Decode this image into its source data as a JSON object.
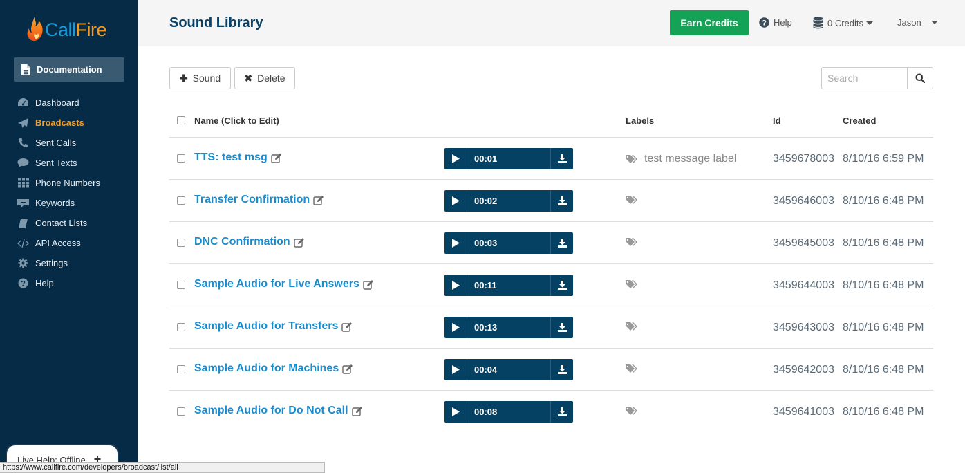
{
  "app": {
    "logo_part1": "Call",
    "logo_part2": "Fire"
  },
  "sidebar": {
    "documentation_label": "Documentation",
    "items": [
      {
        "label": "Dashboard",
        "icon": "dashboard-icon",
        "active": false
      },
      {
        "label": "Broadcasts",
        "icon": "paper-plane-icon",
        "active": true
      },
      {
        "label": "Sent Calls",
        "icon": "phone-icon",
        "active": false
      },
      {
        "label": "Sent Texts",
        "icon": "chat-bubble-icon",
        "active": false
      },
      {
        "label": "Phone Numbers",
        "icon": "keypad-grid-icon",
        "active": false
      },
      {
        "label": "Keywords",
        "icon": "keyword-icon",
        "active": false
      },
      {
        "label": "Contact Lists",
        "icon": "address-book-icon",
        "active": false
      },
      {
        "label": "API Access",
        "icon": "code-icon",
        "active": false
      },
      {
        "label": "Settings",
        "icon": "gear-icon",
        "active": false
      },
      {
        "label": "Help",
        "icon": "question-circle-icon",
        "active": false
      }
    ],
    "live_help_label": "Live Help: Offline"
  },
  "status_bar": {
    "url": "https://www.callfire.com/developers/broadcast/list/all"
  },
  "header": {
    "title": "Sound Library",
    "earn_credits_label": "Earn Credits",
    "help_label": "Help",
    "credits_label": "0 Credits",
    "user_name": "Jason"
  },
  "toolbar": {
    "add_sound_label": "Sound",
    "delete_label": "Delete",
    "search_placeholder": "Search",
    "search_value": ""
  },
  "table": {
    "columns": {
      "name": "Name (Click to Edit)",
      "labels": "Labels",
      "id": "Id",
      "created": "Created"
    },
    "rows": [
      {
        "name": "TTS: test msg",
        "duration": "00:01",
        "label": "test message label",
        "id": "3459678003",
        "created": "8/10/16 6:59 PM"
      },
      {
        "name": "Transfer Confirmation",
        "duration": "00:02",
        "label": "",
        "id": "3459646003",
        "created": "8/10/16 6:48 PM"
      },
      {
        "name": "DNC Confirmation",
        "duration": "00:03",
        "label": "",
        "id": "3459645003",
        "created": "8/10/16 6:48 PM"
      },
      {
        "name": "Sample Audio for Live Answers",
        "duration": "00:11",
        "label": "",
        "id": "3459644003",
        "created": "8/10/16 6:48 PM"
      },
      {
        "name": "Sample Audio for Transfers",
        "duration": "00:13",
        "label": "",
        "id": "3459643003",
        "created": "8/10/16 6:48 PM"
      },
      {
        "name": "Sample Audio for Machines",
        "duration": "00:04",
        "label": "",
        "id": "3459642003",
        "created": "8/10/16 6:48 PM"
      },
      {
        "name": "Sample Audio for Do Not Call",
        "duration": "00:08",
        "label": "",
        "id": "3459641003",
        "created": "8/10/16 6:48 PM"
      }
    ]
  },
  "colors": {
    "sidebar_bg": "#062b47",
    "active_nav": "#f39c1f",
    "link_blue": "#1a8ccd",
    "player_bg": "#054163",
    "earn_green": "#14a356",
    "title_blue": "#0c4266"
  }
}
